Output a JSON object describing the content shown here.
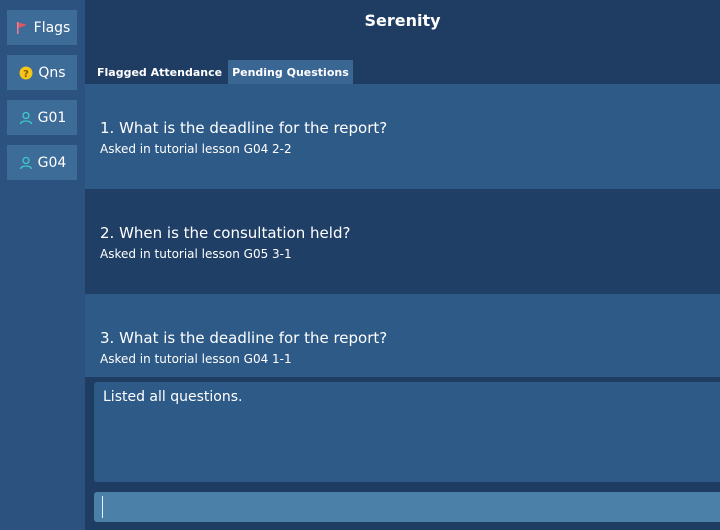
{
  "app": {
    "title": "Serenity"
  },
  "sidebar": {
    "items": [
      {
        "label": "Flags",
        "icon": "flag-icon"
      },
      {
        "label": "Qns",
        "icon": "question-icon"
      },
      {
        "label": "G01",
        "icon": "person-icon"
      },
      {
        "label": "G04",
        "icon": "person-icon"
      }
    ]
  },
  "tabs": [
    {
      "label": "Flagged Attendance",
      "active": false
    },
    {
      "label": "Pending Questions",
      "active": true
    }
  ],
  "questions": [
    {
      "text": "1.  What is the deadline for the report?",
      "sub": "Asked in tutorial lesson G04 2-2"
    },
    {
      "text": "2.  When is the consultation held?",
      "sub": "Asked in tutorial lesson G05 3-1"
    },
    {
      "text": "3.  What is the deadline for the report?",
      "sub": "Asked in tutorial lesson G04 1-1"
    }
  ],
  "result": {
    "text": "Listed all questions."
  },
  "command": {
    "value": "",
    "placeholder": ""
  },
  "colors": {
    "background": "#1f3d63",
    "sidebar": "#2c5380",
    "sidebar_button": "#3d6c99",
    "row_light": "#2e5a88",
    "row_dark": "#1f3f66",
    "command_box": "#4b80a8",
    "flag_red": "#e05560",
    "question_yellow": "#f5c518",
    "person_teal": "#3ec9c9"
  }
}
